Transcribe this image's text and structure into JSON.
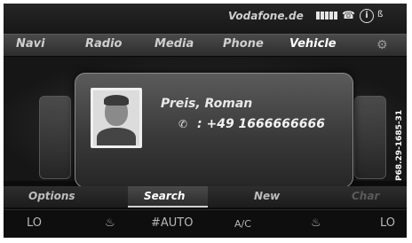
{
  "status_bar": {
    "carrier": "Vodafone.de",
    "signal_bars": 5,
    "handset_icon": "handset-icon",
    "info_icon": "i",
    "bluetooth_label": "ß"
  },
  "main_menu": {
    "items": [
      {
        "label": "Navi"
      },
      {
        "label": "Radio"
      },
      {
        "label": "Media"
      },
      {
        "label": "Phone"
      },
      {
        "label": "Vehicle"
      }
    ],
    "settings_icon": "gear-icon"
  },
  "contact": {
    "name": "Preis, Roman",
    "phone_icon": "phone-icon",
    "number": ": +49 1666666666"
  },
  "softkeys": {
    "options": "Options",
    "search": "Search",
    "new": "New",
    "dim_label": "Char"
  },
  "climate": {
    "left_temp": "LO",
    "left_seat_icon": "seat-icon",
    "fan": "#AUTO",
    "ac": "A/C",
    "right_seat_icon": "seat-icon",
    "right_temp": "LO"
  },
  "watermark": "P68.29-1685-31",
  "colors": {
    "background": "#0c0c0c",
    "text": "#cfcfcf",
    "highlight": "#ffffff"
  }
}
